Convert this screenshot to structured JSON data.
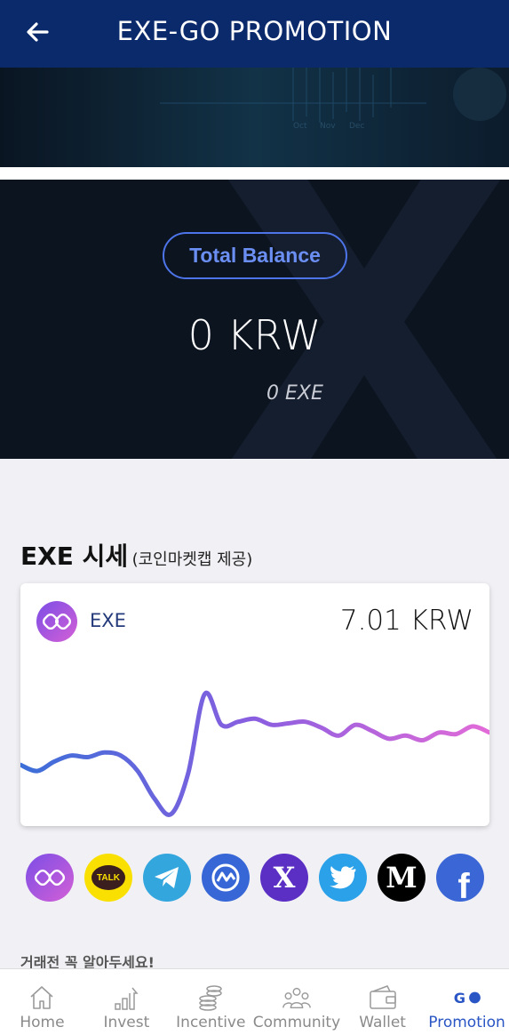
{
  "header": {
    "title": "EXE-GO PROMOTION"
  },
  "balance": {
    "label": "Total Balance",
    "krw": "0 KRW",
    "exe": "0 EXE"
  },
  "section": {
    "title": "EXE 시세",
    "subtitle": "(코인마켓캡 제공)"
  },
  "price_card": {
    "coin_name": "EXE",
    "price": "7.01 KRW"
  },
  "chart_data": {
    "type": "line",
    "series": [
      {
        "values": [
          0.34,
          0.3,
          0.36,
          0.4,
          0.39,
          0.42,
          0.4,
          0.3,
          0.12,
          0.02,
          0.28,
          0.8,
          0.6,
          0.62,
          0.64,
          0.6,
          0.61,
          0.62,
          0.58,
          0.53,
          0.6,
          0.56,
          0.51,
          0.53,
          0.5,
          0.55,
          0.54,
          0.59,
          0.55
        ]
      }
    ],
    "colors": [
      "#3b6fd8",
      "#8a5ee0",
      "#e26bd8"
    ]
  },
  "socials": [
    {
      "name": "exe-logo"
    },
    {
      "name": "kakao-talk",
      "text": "TALK"
    },
    {
      "name": "telegram"
    },
    {
      "name": "coinmarketcap"
    },
    {
      "name": "x-logo",
      "text": "X"
    },
    {
      "name": "twitter"
    },
    {
      "name": "medium",
      "text": "M"
    },
    {
      "name": "facebook",
      "text": "f"
    }
  ],
  "notice": "거래전 꼭 알아두세요!",
  "nav": [
    {
      "label": "Home",
      "icon": "home-icon"
    },
    {
      "label": "Invest",
      "icon": "bar-chart-icon"
    },
    {
      "label": "Incentive",
      "icon": "coins-icon"
    },
    {
      "label": "Community",
      "icon": "people-icon"
    },
    {
      "label": "Wallet",
      "icon": "wallet-icon"
    },
    {
      "label": "Promotion",
      "icon": "go-icon"
    }
  ]
}
